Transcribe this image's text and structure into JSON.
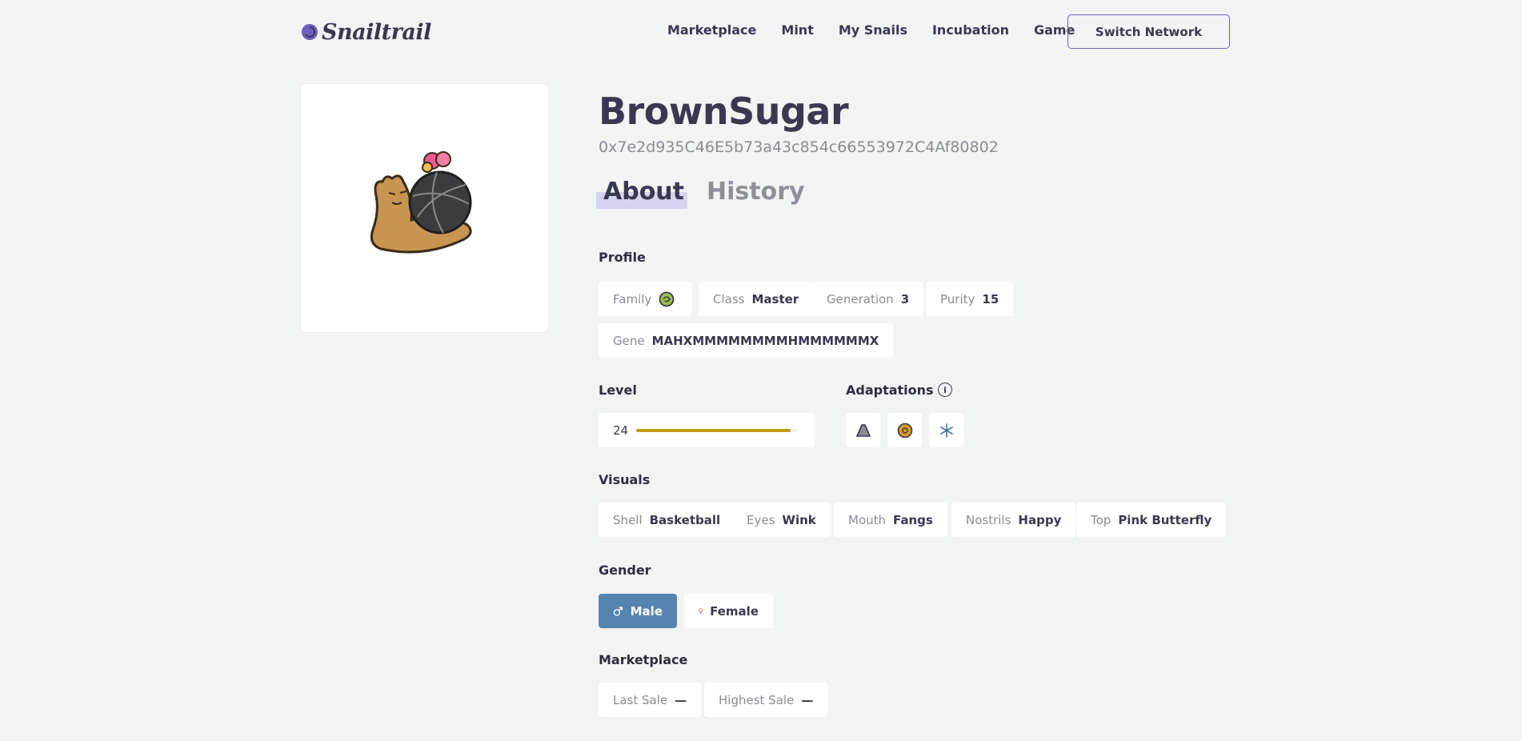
{
  "header": {
    "logo_text": "Snailtrail",
    "nav": [
      "Marketplace",
      "Mint",
      "My Snails",
      "Incubation",
      "Game"
    ],
    "switch_network": "Switch Network"
  },
  "snail": {
    "name": "BrownSugar",
    "address": "0x7e2d935C46E5b73a43c854c66553972C4Af80802"
  },
  "tabs": {
    "about": "About",
    "history": "History"
  },
  "profile": {
    "title": "Profile",
    "family_label": "Family",
    "family_icon": "family-badge-icon",
    "class_label": "Class",
    "class_value": "Master",
    "generation_label": "Generation",
    "generation_value": "3",
    "purity_label": "Purity",
    "purity_value": "15",
    "gene_label": "Gene",
    "gene_value": "MAHXMMMMMMMMHMMMMMMX"
  },
  "level": {
    "title": "Level",
    "value": "24",
    "progress": 0.96,
    "bar_color": "#c29a1a"
  },
  "adaptations": {
    "title": "Adaptations",
    "info_icon": "info-icon",
    "icons": [
      "mountain-icon",
      "slide-coin-icon",
      "snowflake-icon"
    ]
  },
  "visuals": {
    "title": "Visuals",
    "items": [
      {
        "label": "Shell",
        "value": "Basketball"
      },
      {
        "label": "Eyes",
        "value": "Wink"
      },
      {
        "label": "Mouth",
        "value": "Fangs"
      },
      {
        "label": "Nostrils",
        "value": "Happy"
      },
      {
        "label": "Top",
        "value": "Pink Butterfly"
      }
    ]
  },
  "gender": {
    "title": "Gender",
    "male": "Male",
    "female": "Female",
    "selected": "Male",
    "selected_color": "#5584b1"
  },
  "marketplace": {
    "title": "Marketplace",
    "last_sale_label": "Last Sale",
    "last_sale_value": "—",
    "highest_sale_label": "Highest Sale",
    "highest_sale_value": "—"
  }
}
